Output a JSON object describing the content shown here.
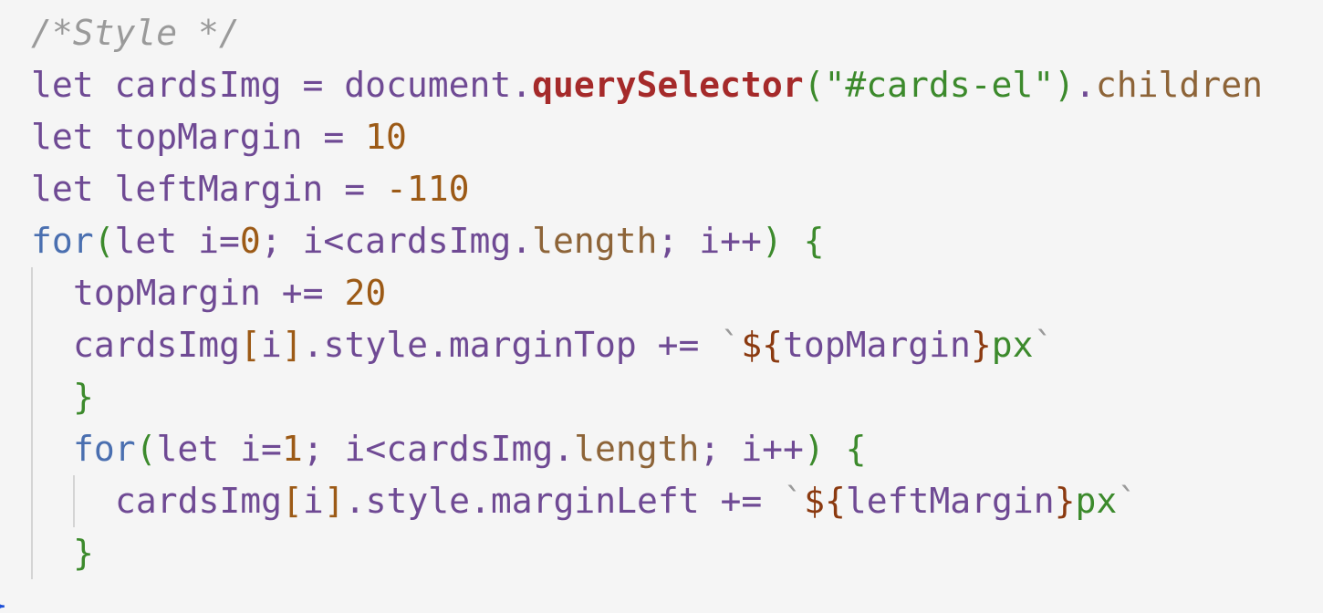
{
  "code": {
    "line1": {
      "comment": "/*Style */"
    },
    "line2": {
      "kw": "let",
      "var": "cardsImg",
      "op": "=",
      "obj": "document",
      "dot1": ".",
      "func": "querySelector",
      "paren_open": "(",
      "str": "\"#cards-el\"",
      "paren_close": ")",
      "dot2": ".",
      "prop": "children"
    },
    "line3": {
      "kw": "let",
      "var": "topMargin",
      "op": "=",
      "num": "10"
    },
    "line4": {
      "kw": "let",
      "var": "leftMargin",
      "op": "=",
      "num": "-110"
    },
    "line5": {
      "ctrl": "for",
      "paren_open": "(",
      "kw": "let",
      "cond_start": "i=",
      "num": "0",
      "sep1": ";",
      "cond_mid": "i<cardsImg",
      "dot": ".",
      "prop": "length",
      "sep2": ";",
      "incr": "i++",
      "paren_close": ")",
      "brace": "{"
    },
    "line6": {
      "var": "topMargin",
      "op": "+=",
      "num": "20"
    },
    "line7": {
      "obj": "cardsImg",
      "bracket_open": "[",
      "index": "i",
      "bracket_close": "]",
      "access": ".style.marginTop",
      "op": "+=",
      "tick_open": "`",
      "interp_open": "${",
      "interp_var": "topMargin",
      "interp_close": "}",
      "unit": "px",
      "tick_close": "`"
    },
    "line8": {
      "brace": "}"
    },
    "line9": {
      "ctrl": "for",
      "paren_open": "(",
      "kw": "let",
      "cond_start": "i=",
      "num": "1",
      "sep1": ";",
      "cond_mid": "i<cardsImg",
      "dot": ".",
      "prop": "length",
      "sep2": ";",
      "incr": "i++",
      "paren_close": ")",
      "brace": "{"
    },
    "line10": {
      "obj": "cardsImg",
      "bracket_open": "[",
      "index": "i",
      "bracket_close": "]",
      "access": ".style.marginLeft",
      "op": "+=",
      "tick_open": "`",
      "interp_open": "${",
      "interp_var": "leftMargin",
      "interp_close": "}",
      "unit": "px",
      "tick_close": "`"
    },
    "line11": {
      "brace": "}"
    },
    "line12": {
      "brace": "}"
    }
  },
  "colors": {
    "background": "#f5f5f5",
    "keyword": "#6f4a94",
    "control": "#4a6fb0",
    "number": "#9c5a16",
    "string": "#3c8a2c",
    "function": "#a52a2a",
    "comment": "#9a9a9a",
    "guide": "#d4d4d4"
  }
}
